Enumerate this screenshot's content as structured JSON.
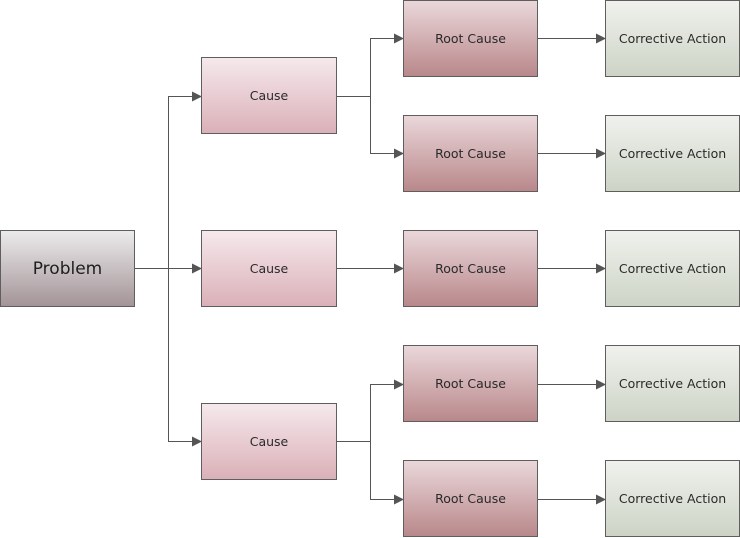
{
  "diagram": {
    "problem": {
      "label": "Problem"
    },
    "causes": [
      {
        "label": "Cause",
        "roots": [
          {
            "label": "Root Cause",
            "action": "Corrective Action"
          },
          {
            "label": "Root Cause",
            "action": "Corrective Action"
          }
        ]
      },
      {
        "label": "Cause",
        "roots": [
          {
            "label": "Root Cause",
            "action": "Corrective Action"
          }
        ]
      },
      {
        "label": "Cause",
        "roots": [
          {
            "label": "Root Cause",
            "action": "Corrective Action"
          },
          {
            "label": "Root Cause",
            "action": "Corrective Action"
          }
        ]
      }
    ],
    "colors": {
      "line": "#555555",
      "border": "#5e5e5e"
    }
  }
}
